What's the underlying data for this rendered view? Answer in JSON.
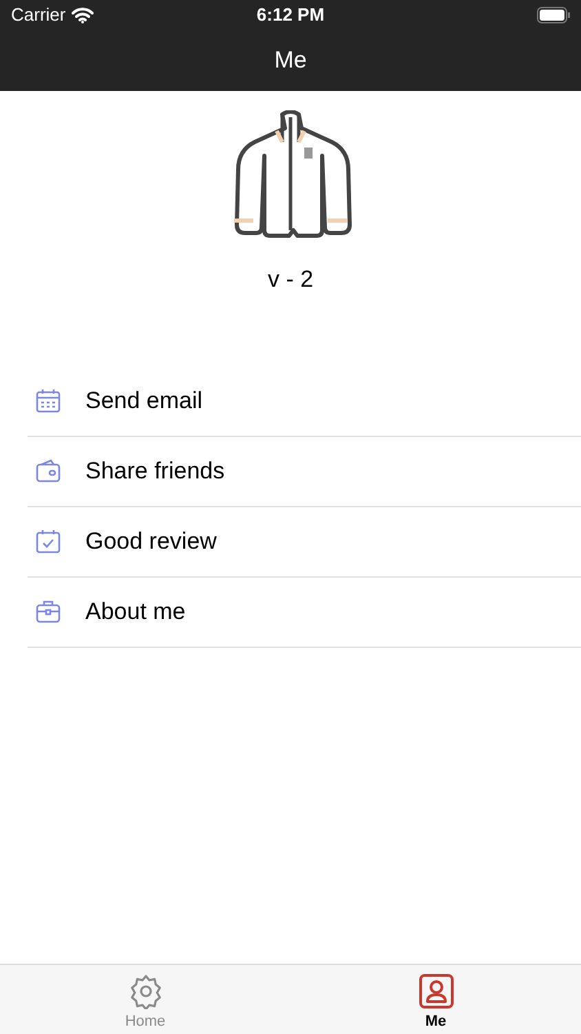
{
  "status_bar": {
    "carrier": "Carrier",
    "time": "6:12 PM"
  },
  "nav": {
    "title": "Me"
  },
  "profile": {
    "version": "v - 2"
  },
  "menu": [
    {
      "kind": "calendar",
      "label": "Send email"
    },
    {
      "kind": "wallet",
      "label": "Share friends"
    },
    {
      "kind": "check",
      "label": "Good review"
    },
    {
      "kind": "briefcase",
      "label": "About me"
    }
  ],
  "tabs": [
    {
      "kind": "gear",
      "label": "Home",
      "selected": false
    },
    {
      "kind": "person",
      "label": "Me",
      "selected": true
    }
  ]
}
